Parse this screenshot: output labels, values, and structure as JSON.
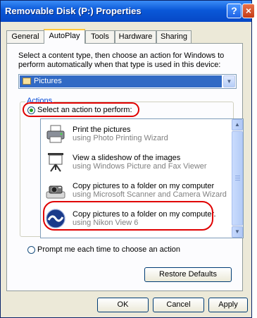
{
  "window": {
    "title": "Removable Disk (P:) Properties",
    "help_label": "?",
    "close_label": "×"
  },
  "tabs": [
    {
      "label": "General",
      "active": false
    },
    {
      "label": "AutoPlay",
      "active": true
    },
    {
      "label": "Tools",
      "active": false
    },
    {
      "label": "Hardware",
      "active": false
    },
    {
      "label": "Sharing",
      "active": false
    }
  ],
  "autoplay": {
    "intro": "Select a content type, then choose an action for Windows to perform automatically when that type is used in this device:",
    "content_type": {
      "value": "Pictures",
      "icon": "pictures-folder-icon"
    },
    "actions_group_label": "Actions",
    "select_action_label": "Select an action to perform:",
    "select_action_checked": true,
    "actions": [
      {
        "line1": "Print the pictures",
        "line2": "using Photo Printing Wizard",
        "icon": "printer-icon"
      },
      {
        "line1": "View a slideshow of the images",
        "line2": "using Windows Picture and Fax Viewer",
        "icon": "projector-screen-icon"
      },
      {
        "line1": "Copy pictures to a folder on my computer",
        "line2": "using Microsoft Scanner and Camera Wizard",
        "icon": "camera-icon"
      },
      {
        "line1": "Copy pictures to a folder on my computer.",
        "line2": "using Nikon View 6",
        "icon": "nikon-view-icon"
      }
    ],
    "prompt_label": "Prompt me each time to choose an action",
    "prompt_checked": false,
    "restore_label": "Restore Defaults"
  },
  "footer": {
    "ok_label": "OK",
    "cancel_label": "Cancel",
    "apply_label": "Apply"
  },
  "colors": {
    "title_bar": "#0a58d8",
    "selection": "#316ac5",
    "highlight_ring": "#e00000"
  }
}
